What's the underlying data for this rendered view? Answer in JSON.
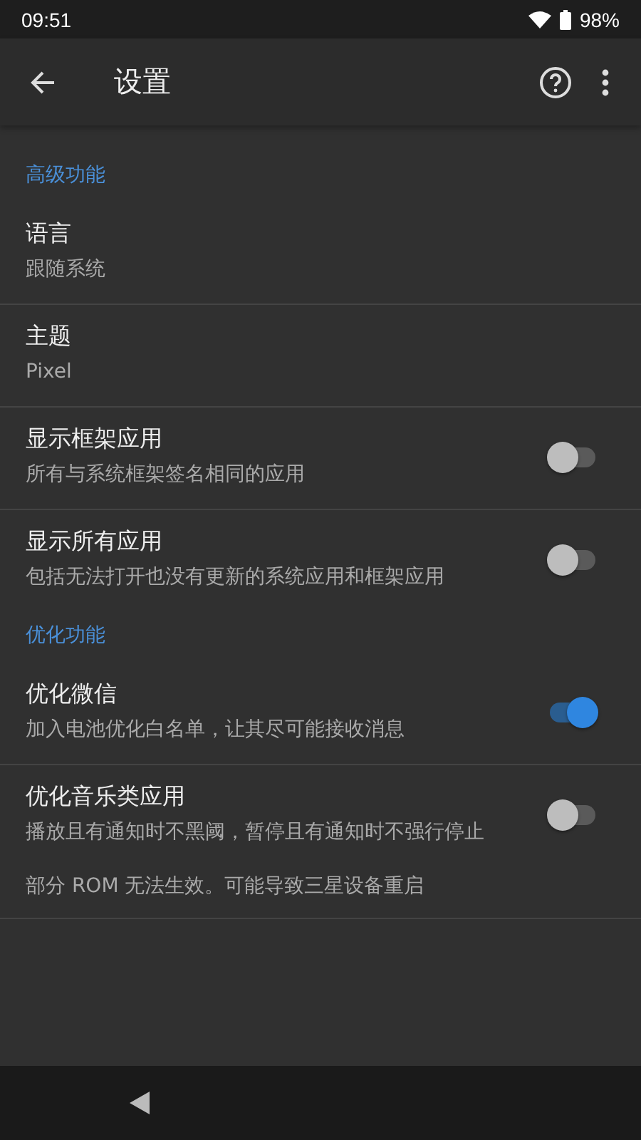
{
  "status_bar": {
    "time": "09:51",
    "battery": "98%"
  },
  "app_bar": {
    "title": "设置"
  },
  "sections": [
    {
      "header": "高级功能",
      "items": [
        {
          "kind": "text",
          "title": "语言",
          "summary": "跟随系统"
        },
        {
          "kind": "text",
          "title": "主题",
          "summary": "Pixel"
        },
        {
          "kind": "switch",
          "title": "显示框架应用",
          "summary": "所有与系统框架签名相同的应用",
          "on": false
        },
        {
          "kind": "switch",
          "title": "显示所有应用",
          "summary": "包括无法打开也没有更新的系统应用和框架应用",
          "on": false
        }
      ]
    },
    {
      "header": "优化功能",
      "items": [
        {
          "kind": "switch",
          "title": "优化微信",
          "summary": "加入电池优化白名单，让其尽可能接收消息",
          "on": true
        },
        {
          "kind": "switch",
          "title": "优化音乐类应用",
          "summary": "播放且有通知时不黑阈，暂停且有通知时不强行停止",
          "on": false,
          "note": "部分 ROM 无法生效。可能导致三星设备重启"
        }
      ]
    }
  ]
}
